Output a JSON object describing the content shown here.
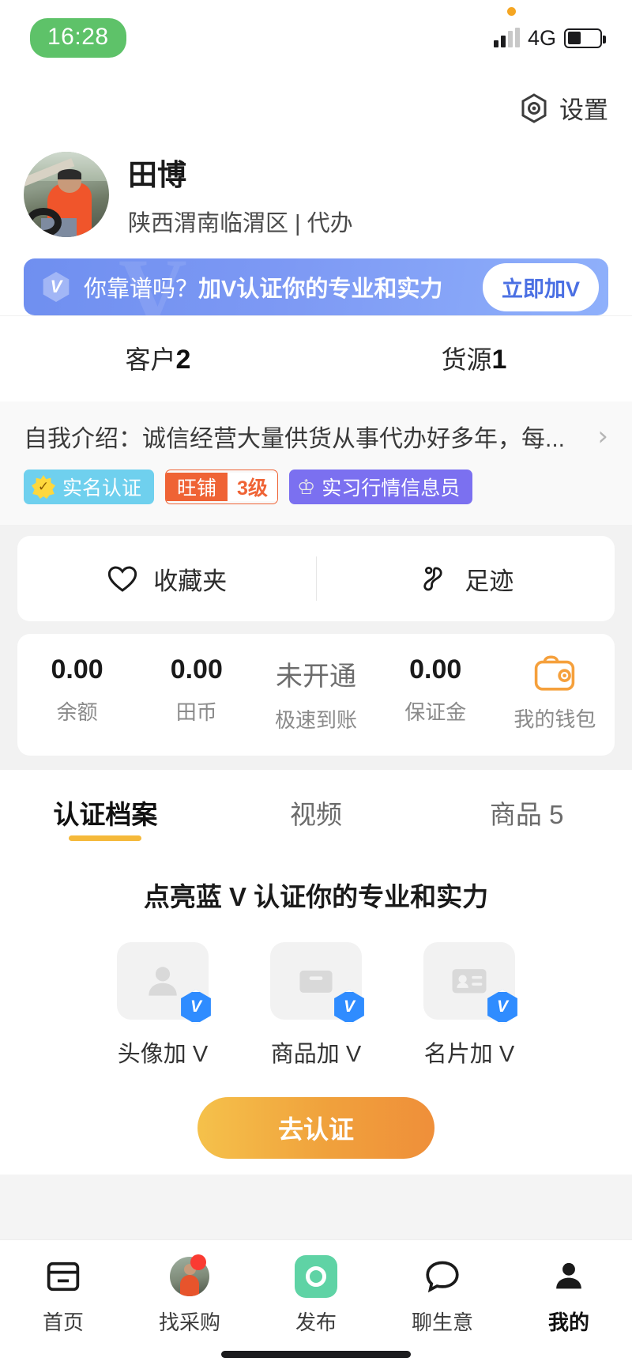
{
  "status_bar": {
    "time": "16:28",
    "network": "4G",
    "time_pill_color": "#5ec269"
  },
  "header": {
    "settings_label": "设置",
    "settings_icon": "gear-hex-icon"
  },
  "profile": {
    "name": "田博",
    "location": "陕西渭南临渭区 | 代办",
    "avatar_icon": "user-photo-avatar"
  },
  "v_banner": {
    "badge_letter": "V",
    "text_lead": "你靠谱吗？",
    "text_bold": "加V认证你的专业和实力",
    "button_label": "立即加V",
    "bg_color": "#7d99f4"
  },
  "stats": [
    {
      "label": "客户",
      "value": "2"
    },
    {
      "label": "货源",
      "value": "1"
    }
  ],
  "intro": {
    "text": "自我介绍：诚信经营大量供货从事代办好多年，每...",
    "chevron": "chevron-right-icon"
  },
  "tags": [
    {
      "id": "real-name",
      "label": "实名认证",
      "icon": "star-check-icon",
      "bg": "#6fd0ee"
    },
    {
      "id": "shop-level",
      "label": "旺铺",
      "value": "3级",
      "color": "#ef6335"
    },
    {
      "id": "market-info",
      "label": "实习行情信息员",
      "icon": "crown-icon",
      "bg": "#7b70f0"
    }
  ],
  "fav_card": [
    {
      "label": "收藏夹",
      "icon": "heart-icon"
    },
    {
      "label": "足迹",
      "icon": "footprint-icon"
    }
  ],
  "wallet": [
    {
      "value": "0.00",
      "label": "余额",
      "muted": false
    },
    {
      "value": "0.00",
      "label": "田币",
      "muted": false
    },
    {
      "value": "未开通",
      "label": "极速到账",
      "muted": true
    },
    {
      "value": "0.00",
      "label": "保证金",
      "muted": false
    },
    {
      "value": "",
      "label": "我的钱包",
      "icon": "wallet-icon",
      "muted": false
    }
  ],
  "tabs": [
    {
      "label": "认证档案",
      "active": true
    },
    {
      "label": "视频",
      "active": false
    },
    {
      "label": "商品 5",
      "active": false
    }
  ],
  "cert": {
    "title": "点亮蓝 V 认证你的专业和实力",
    "items": [
      {
        "label": "头像加 V",
        "icon": "avatar-placeholder-icon",
        "badge": "V"
      },
      {
        "label": "商品加 V",
        "icon": "product-box-icon",
        "badge": "V"
      },
      {
        "label": "名片加 V",
        "icon": "business-card-icon",
        "badge": "V"
      }
    ],
    "button_label": "去认证",
    "button_color": "#f0a13c"
  },
  "bottom_nav": [
    {
      "label": "首页",
      "icon": "home-icon",
      "active": false,
      "badge": false
    },
    {
      "label": "找采购",
      "icon": "avatar-icon",
      "active": false,
      "badge": true
    },
    {
      "label": "发布",
      "icon": "publish-camera-icon",
      "active": false,
      "badge": false
    },
    {
      "label": "聊生意",
      "icon": "chat-bubble-icon",
      "active": false,
      "badge": false
    },
    {
      "label": "我的",
      "icon": "person-icon",
      "active": true,
      "badge": false
    }
  ]
}
